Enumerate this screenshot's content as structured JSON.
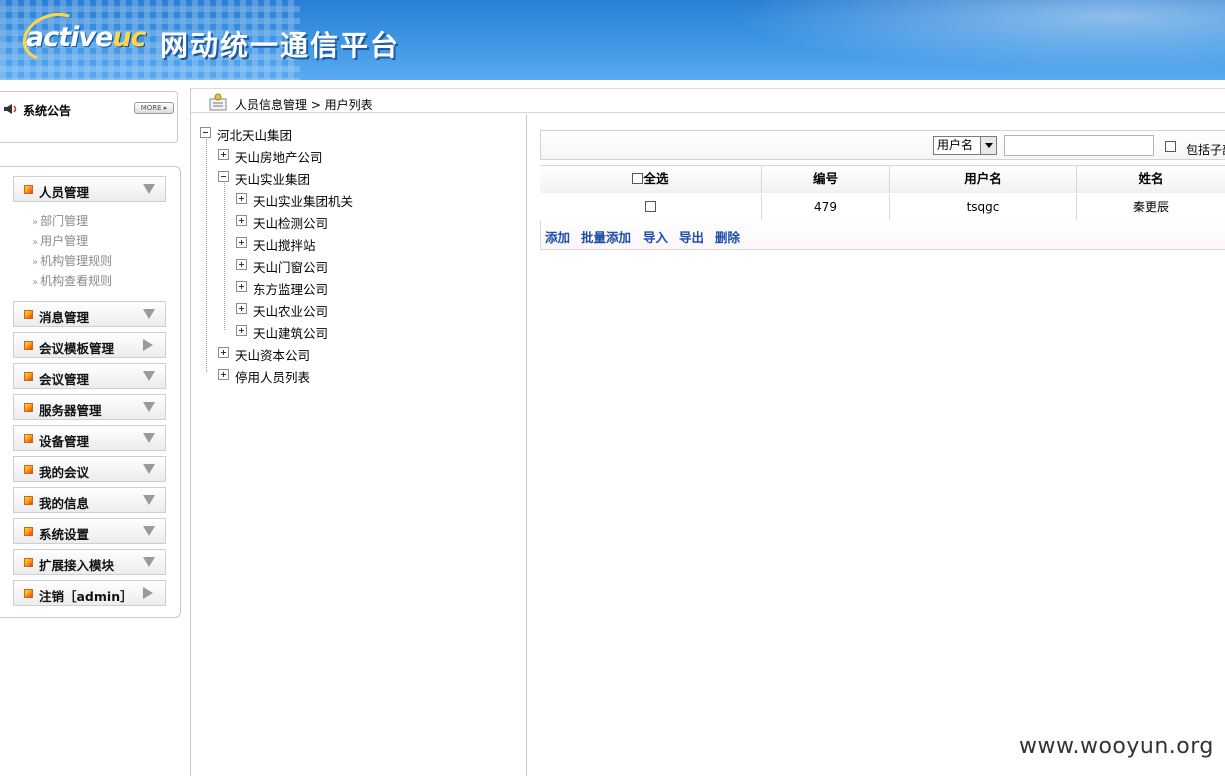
{
  "header": {
    "logo_main": "active",
    "logo_accent": "uc",
    "app_title": "网动统一通信平台"
  },
  "notice": {
    "title": "系统公告",
    "more": "MORE"
  },
  "menu": {
    "items": [
      {
        "label": "人员管理",
        "arrow": "down"
      },
      {
        "label": "消息管理",
        "arrow": "down"
      },
      {
        "label": "会议模板管理",
        "arrow": "right"
      },
      {
        "label": "会议管理",
        "arrow": "down"
      },
      {
        "label": "服务器管理",
        "arrow": "down"
      },
      {
        "label": "设备管理",
        "arrow": "down"
      },
      {
        "label": "我的会议",
        "arrow": "down"
      },
      {
        "label": "我的信息",
        "arrow": "down"
      },
      {
        "label": "系统设置",
        "arrow": "down"
      },
      {
        "label": "扩展接入模块",
        "arrow": "down"
      },
      {
        "label": "注销［admin］",
        "arrow": "right"
      }
    ],
    "submenu": [
      "部门管理",
      "用户管理",
      "机构管理规则",
      "机构查看规则"
    ]
  },
  "breadcrumb": "人员信息管理 > 用户列表",
  "tree": {
    "root": "河北天山集团",
    "nodes": [
      "天山房地产公司",
      "天山实业集团",
      "天山实业集团机关",
      "天山检测公司",
      "天山搅拌站",
      "天山门窗公司",
      "东方监理公司",
      "天山农业公司",
      "天山建筑公司",
      "天山资本公司",
      "停用人员列表"
    ]
  },
  "search": {
    "field_selected": "用户名",
    "value": "",
    "include_sub": "包括子部"
  },
  "table": {
    "select_all": "全选",
    "columns": [
      "编号",
      "用户名",
      "姓名"
    ],
    "rows": [
      {
        "id": "479",
        "username": "tsqgc",
        "name": "秦更辰"
      }
    ]
  },
  "actions": [
    "添加",
    "批量添加",
    "导入",
    "导出",
    "删除"
  ],
  "watermark": "www.wooyun.org",
  "colors": {
    "header_blue": "#2a7fd4",
    "action_link": "#1a4ea8",
    "menu_square": "#ff9a1a"
  }
}
